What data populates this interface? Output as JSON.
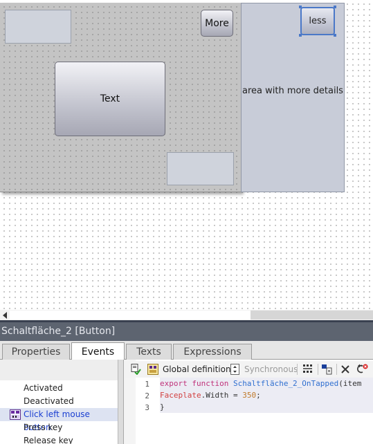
{
  "canvas": {
    "more_button": "More",
    "main_button": "Text",
    "less_button": "less",
    "detail_label": "area with more details"
  },
  "properties_header": {
    "title": "Schaltfläche_2 [Button]"
  },
  "tabs": [
    {
      "label": "Properties",
      "active": false
    },
    {
      "label": "Events",
      "active": true
    },
    {
      "label": "Texts",
      "active": false
    },
    {
      "label": "Expressions",
      "active": false
    }
  ],
  "events": [
    {
      "label": "Activated",
      "selected": false
    },
    {
      "label": "Deactivated",
      "selected": false
    },
    {
      "label": "Click left mouse button",
      "selected": true
    },
    {
      "label": "Press key",
      "selected": false
    },
    {
      "label": "Release key",
      "selected": false
    }
  ],
  "code_toolbar": {
    "definition_label": "Global definition",
    "mode_label": "Synchronous"
  },
  "code": {
    "line_numbers": [
      "1",
      "2",
      "3"
    ],
    "line1": {
      "keyword": "export function ",
      "function_name": "Schaltfläche_2_OnTapped",
      "rest": "(item"
    },
    "line2": {
      "object": "Faceplate",
      "property": ".Width = ",
      "value": "350",
      "end": ";"
    },
    "line3": "}"
  },
  "colors": {
    "selection_blue": "#4a78c8",
    "header_bg": "#5d6470",
    "selected_event_text": "#1a3fd1"
  }
}
